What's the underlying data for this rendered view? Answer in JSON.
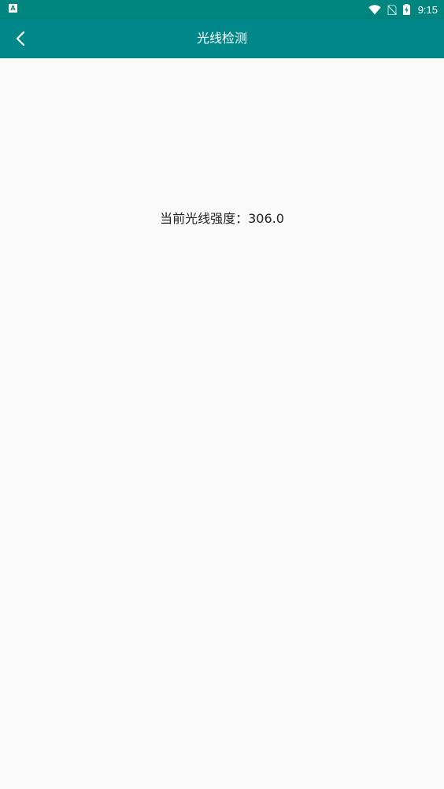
{
  "status_bar": {
    "notification_icon_letter": "A",
    "time": "9:15",
    "icons": [
      "wifi-icon",
      "no-sim-icon",
      "battery-charging-icon"
    ],
    "color": "#00857f"
  },
  "app_bar": {
    "title": "光线检测",
    "back_icon": "chevron-left-icon",
    "color": "#00878a"
  },
  "main": {
    "light_label": "当前光线强度：",
    "light_value": "306.0"
  }
}
